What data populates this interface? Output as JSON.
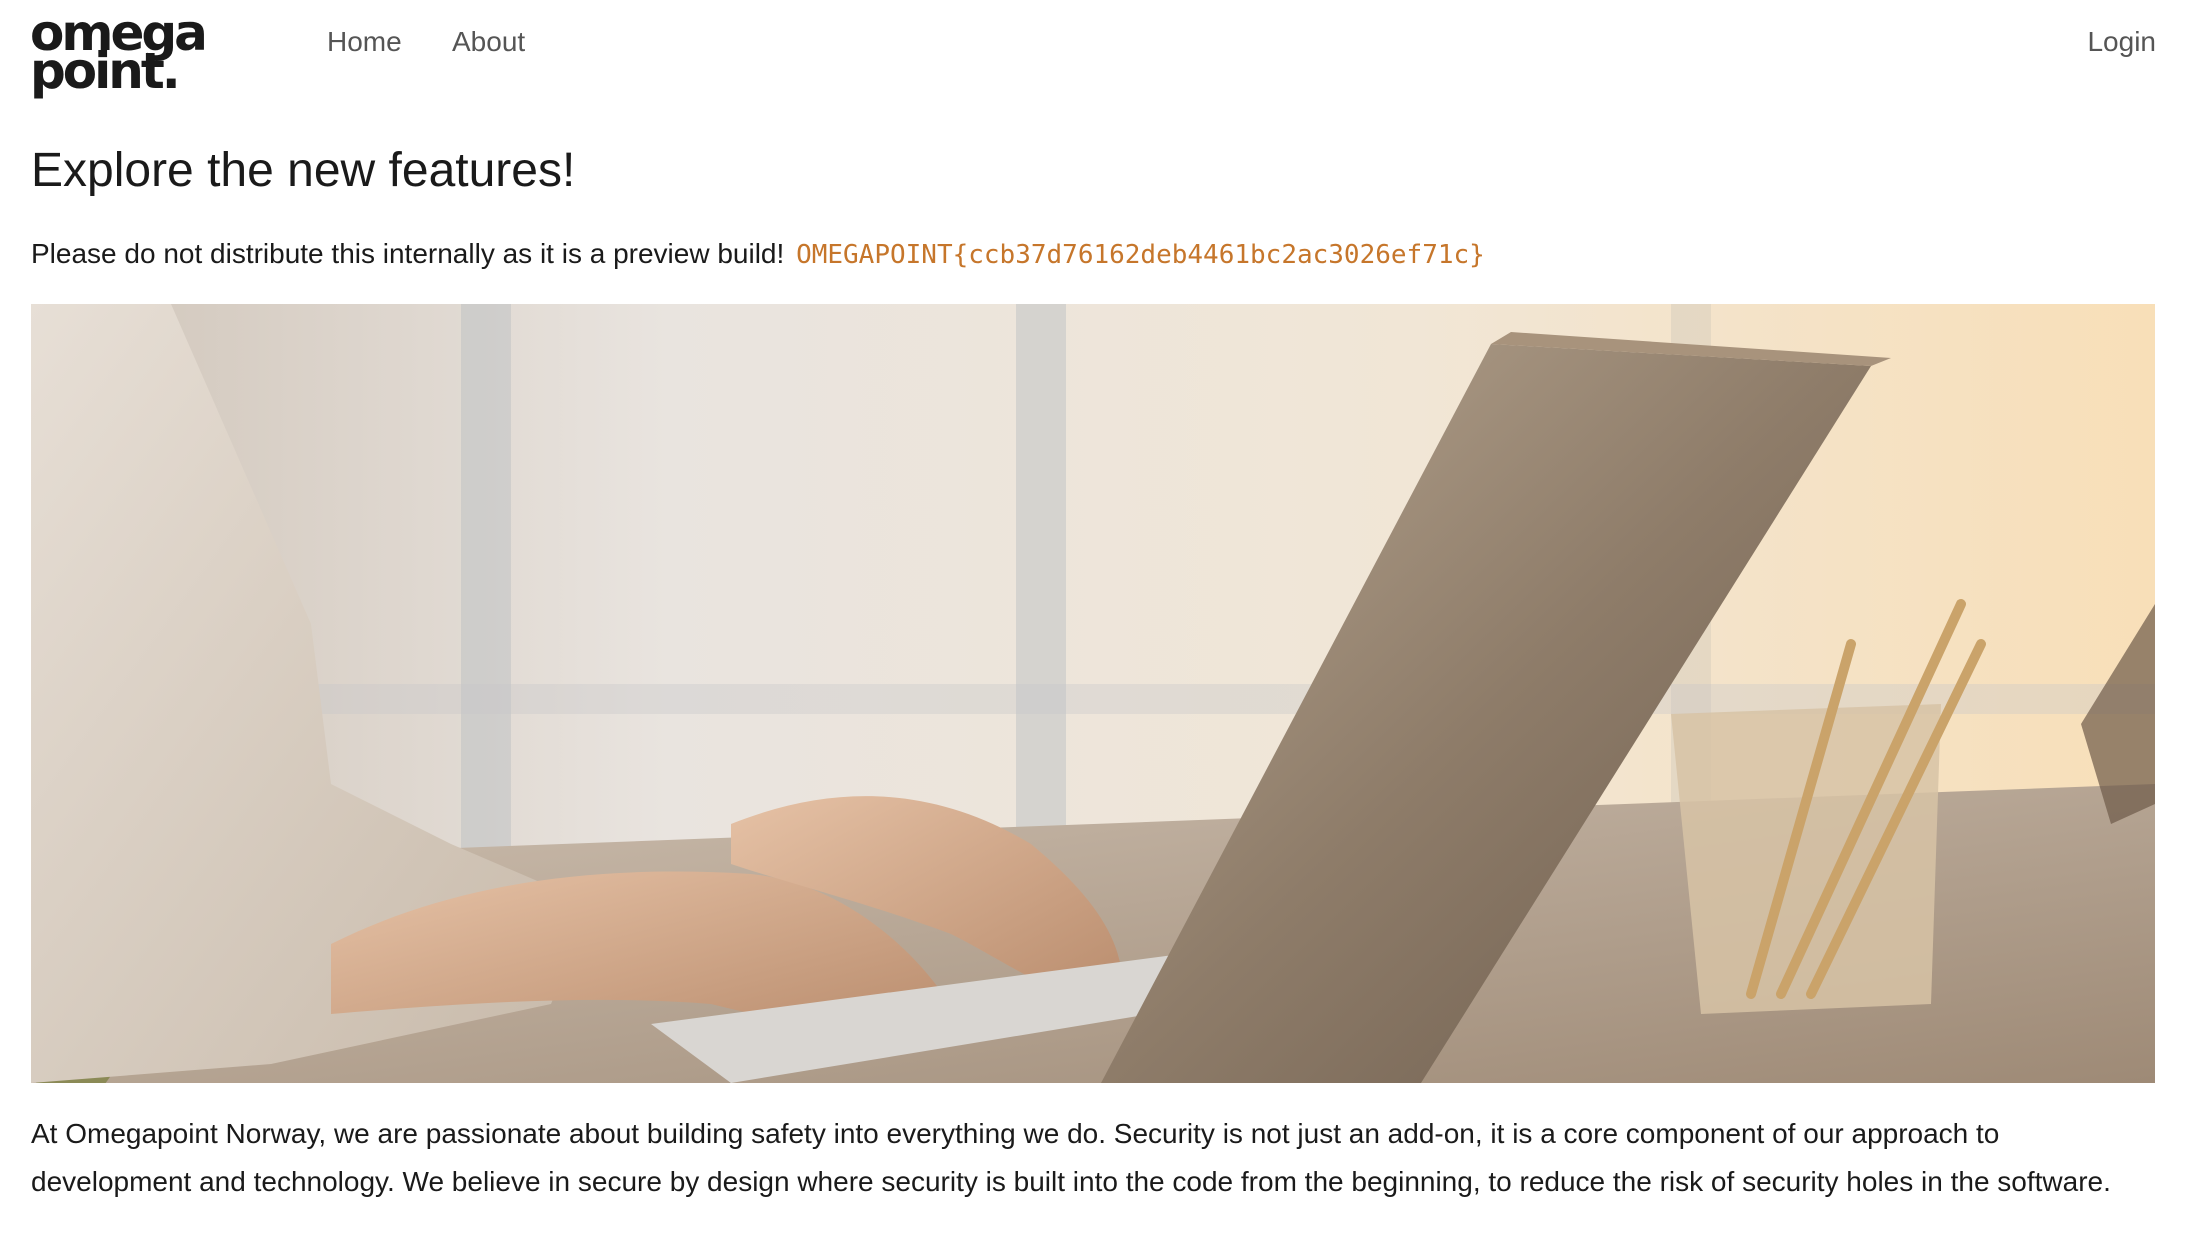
{
  "nav": {
    "logo_line1": "omega",
    "logo_line2": "point.",
    "home": "Home",
    "about": "About",
    "login": "Login"
  },
  "main": {
    "title": "Explore the new features!",
    "notice": "Please do not distribute this internally as it is a preview build!",
    "flag": "OMEGAPOINT{ccb37d76162deb4461bc2ac3026ef71c}",
    "paragraph": "At Omegapoint Norway, we are passionate about building safety into everything we do. Security is not just an add-on, it is a core component of our approach to development and technology. We believe in secure by design where security is built into the code from the beginning, to reduce the risk of security holes in the software."
  },
  "colors": {
    "flag": "#c6762b",
    "nav_link": "#555555",
    "text": "#1a1a1a"
  }
}
